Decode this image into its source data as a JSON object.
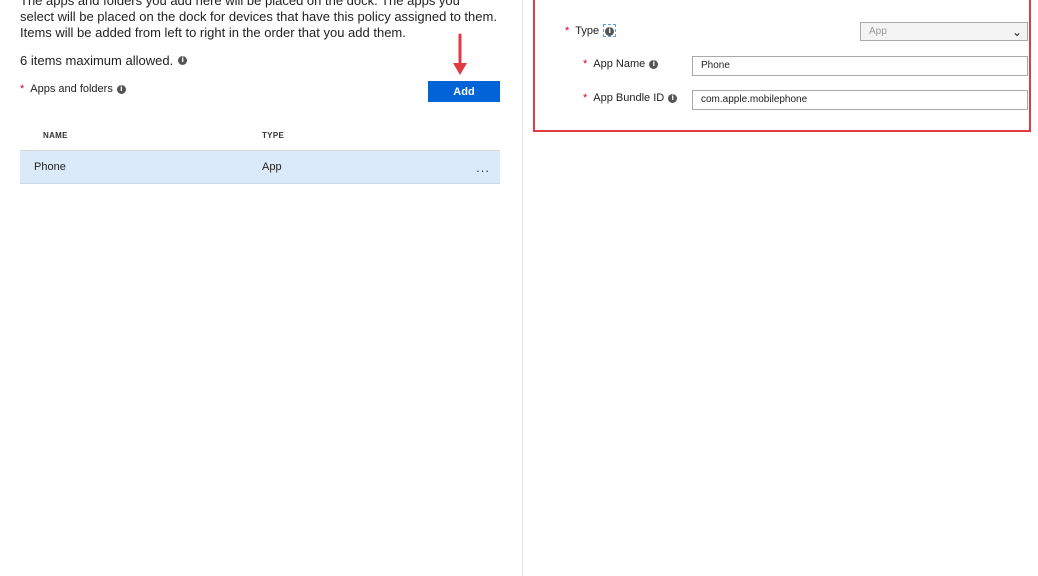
{
  "description": {
    "line1": "The apps and folders you add here will be placed on the dock. The apps you",
    "line2": "select will be placed on the dock for devices that have this policy assigned to them.",
    "line3": "Items will be added from left to right in the order that you add them."
  },
  "max_items_text": "6 items maximum allowed.",
  "apps_and_folders_label": "Apps and folders",
  "add_button_label": "Add",
  "table": {
    "headers": [
      "NAME",
      "TYPE"
    ],
    "rows": [
      {
        "name": "Phone",
        "type": "App",
        "more": "..."
      }
    ]
  },
  "panel": {
    "type_label": "Type",
    "type_value": "App",
    "app_name_label": "App Name",
    "app_name_value": "Phone",
    "bundle_id_label": "App Bundle ID",
    "bundle_id_value": "com.apple.mobilephone"
  },
  "required_marker": "*",
  "info_glyph": "i",
  "colors": {
    "accent": "#0063d8",
    "selected_row": "#dbeaf8",
    "highlight_border": "#e03a45",
    "required_star": "#d9001b"
  }
}
